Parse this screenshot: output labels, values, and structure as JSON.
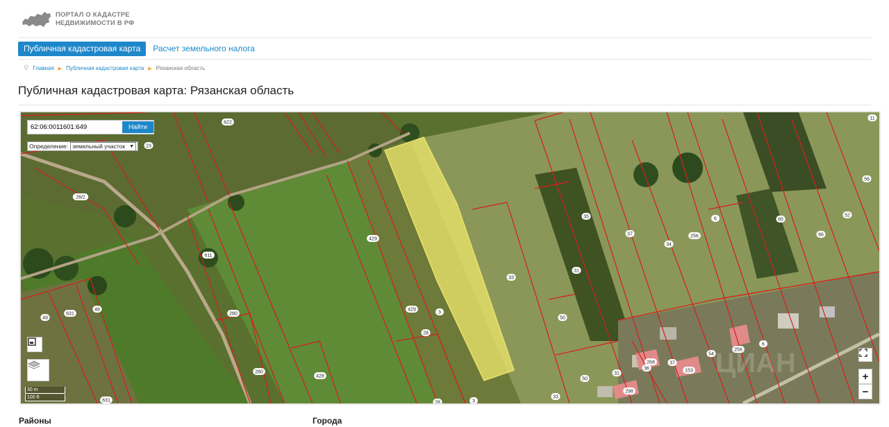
{
  "header": {
    "logo_line1": "ПОРТАЛ О КАДАСТРЕ",
    "logo_line2": "НЕДВИЖИМОСТИ В РФ"
  },
  "tabs": [
    {
      "label": "Публичная кадастровая карта",
      "active": true
    },
    {
      "label": "Расчет земельного налога",
      "active": false
    }
  ],
  "breadcrumb": [
    "Главная",
    "Публичная кадастровая карта",
    "Рязанская область"
  ],
  "page_title": "Публичная кадастровая карта: Рязанская область",
  "map": {
    "search_value": "62:06:0011601:649",
    "search_button": "Найти",
    "definition_label": "Определение:",
    "definition_value": "земельный участок",
    "scale_m": "30 m",
    "scale_ft": "100 ft",
    "zoom_in": "+",
    "zoom_out": "−",
    "parcel_labels": [
      "622",
      "23",
      "26/2",
      "429",
      "429",
      "3",
      "28",
      "33",
      "31",
      "50",
      "35",
      "37",
      "34",
      "256",
      "6",
      "65",
      "66",
      "52",
      "56",
      "11",
      "611",
      "280",
      "280",
      "48",
      "49",
      "631",
      "631",
      "428",
      "28",
      "3",
      "33",
      "50",
      "31",
      "268",
      "36",
      "37",
      "153",
      "54",
      "256",
      "6",
      "298"
    ],
    "watermark": "ЦИАН"
  },
  "sections": {
    "districts": "Районы",
    "cities": "Города"
  },
  "colors": {
    "accent": "#1e87c9",
    "parcel_border": "#d81e1e",
    "highlight": "#e9e26a"
  }
}
